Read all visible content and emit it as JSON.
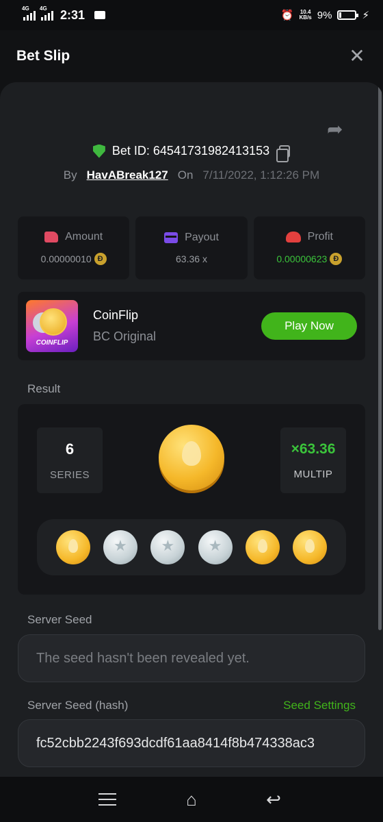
{
  "status_bar": {
    "net1": "4G",
    "net2": "4G",
    "time": "2:31",
    "speed_value": "10.4",
    "speed_unit": "KB/s",
    "battery": "9%"
  },
  "header": {
    "title": "Bet Slip",
    "close_icon": "close-icon"
  },
  "bet": {
    "id_label": "Bet ID: 64541731982413153",
    "by_label": "By",
    "user": "HavABreak127",
    "on_label": "On",
    "date": "7/11/2022, 1:12:26 PM"
  },
  "stats": {
    "amount": {
      "label": "Amount",
      "value": "0.00000010"
    },
    "payout": {
      "label": "Payout",
      "value": "63.36 x"
    },
    "profit": {
      "label": "Profit",
      "value": "0.00000623"
    },
    "currency_symbol": "Đ"
  },
  "game": {
    "thumb_text": "COINFLIP",
    "name": "CoinFlip",
    "subtitle": "BC Original",
    "play_label": "Play Now"
  },
  "result": {
    "section_label": "Result",
    "series_value": "6",
    "series_caption": "SERIES",
    "multiplier_value": "×63.36",
    "multiplier_caption": "MULTIP",
    "coins": [
      "gold",
      "silver",
      "silver",
      "silver",
      "gold",
      "gold"
    ]
  },
  "server_seed": {
    "label": "Server Seed",
    "placeholder": "The seed hasn't been revealed yet."
  },
  "server_seed_hash": {
    "label": "Server Seed (hash)",
    "settings_link": "Seed Settings",
    "value": "fc52cbb2243f693dcdf61aa8414f8b474338ac3"
  },
  "colors": {
    "accent_green": "#41b41b",
    "profit_green": "#3bc43b",
    "panel_bg": "#1d1f22"
  }
}
